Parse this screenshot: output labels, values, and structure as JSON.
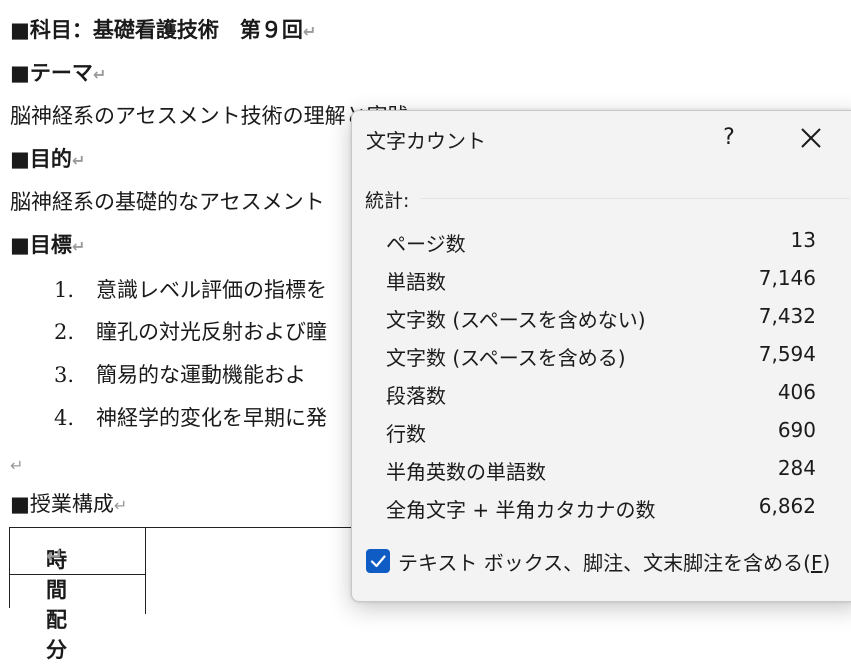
{
  "document": {
    "line1": "■科目：基礎看護技術　第９回",
    "line2": "■テーマ",
    "line3": "脳神経系のアセスメント技術の理解と実践",
    "line4": "■目的",
    "line5": "脳神経系の基礎的なアセスメント",
    "line6": "■目標",
    "list": [
      {
        "num": "1.",
        "text": "意識レベル評価の指標を"
      },
      {
        "num": "2.",
        "text": "瞳孔の対光反射および瞳"
      },
      {
        "num": "3.",
        "text": "簡易的な運動機能およ"
      },
      {
        "num": "4.",
        "text": "神経学的変化を早期に発"
      }
    ],
    "line_empty_mark": "↵",
    "line7": "■授業構成",
    "table_header": "時間配分",
    "paragraph_mark": "↵"
  },
  "dialog": {
    "title": "文字カウント",
    "help": "?",
    "statistics_label": "統計:",
    "stats": [
      {
        "label": "ページ数",
        "value": "13"
      },
      {
        "label": "単語数",
        "value": "7,146"
      },
      {
        "label": "文字数 (スペースを含めない)",
        "value": "7,432"
      },
      {
        "label": "文字数 (スペースを含める)",
        "value": "7,594"
      },
      {
        "label": "段落数",
        "value": "406"
      },
      {
        "label": "行数",
        "value": "690"
      },
      {
        "label": "半角英数の単語数",
        "value": "284"
      },
      {
        "label": "全角文字 + 半角カタカナの数",
        "value": "6,862"
      }
    ],
    "checkbox_label": "テキスト ボックス、脚注、文末脚注を含める(",
    "checkbox_key": "F",
    "checkbox_close": ")",
    "checkbox_checked": true,
    "accent_color": "#0f5cc4"
  }
}
